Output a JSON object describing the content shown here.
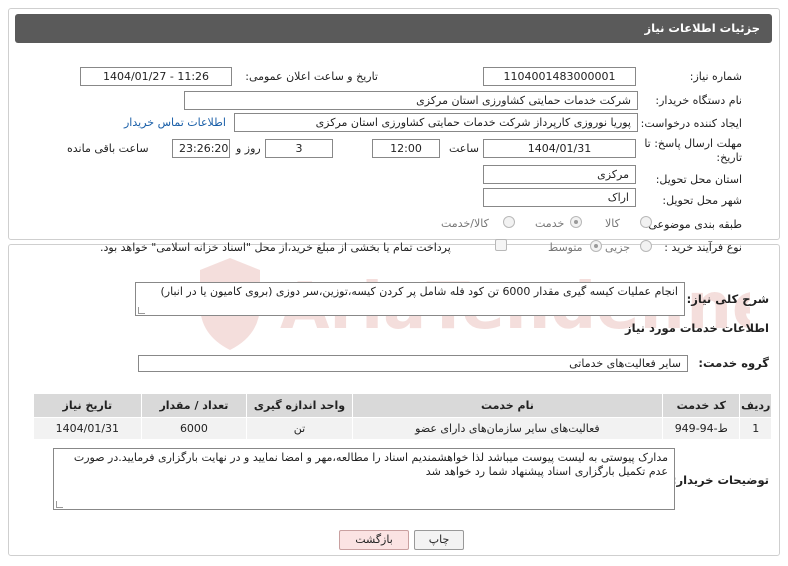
{
  "header": {
    "title": "جزئیات اطلاعات نیاز"
  },
  "fields": {
    "need_number": {
      "label": "شماره نیاز:",
      "value": "1104001483000001"
    },
    "announce_datetime": {
      "label": "تاریخ و ساعت اعلان عمومی:",
      "value": "1404/01/27 - 11:26"
    },
    "buyer_org": {
      "label": "نام دستگاه خریدار:",
      "value": "شرکت خدمات حمایتی کشاورزی استان مرکزی"
    },
    "requester": {
      "label": "ایجاد کننده درخواست:",
      "value": "پوریا نوروزی کارپرداز شرکت خدمات حمایتی کشاورزی استان مرکزی"
    },
    "buyer_contact_link": "اطلاعات تماس خریدار",
    "deadline": {
      "label_line1": "مهلت ارسال پاسخ: تا",
      "label_line2": "تاریخ:",
      "date": "1404/01/31",
      "time_label": "ساعت",
      "time": "12:00",
      "days": "3",
      "days_label": "روز و",
      "remaining": "23:26:20",
      "remaining_label": "ساعت باقی مانده"
    },
    "delivery_province": {
      "label": "استان محل تحویل:",
      "value": "مرکزی"
    },
    "delivery_city": {
      "label": "شهر محل تحویل:",
      "value": "اراک"
    },
    "category": {
      "label": "طبقه بندی موضوعی:",
      "options": [
        "کالا",
        "خدمت",
        "کالا/خدمت"
      ],
      "selected": "خدمت"
    },
    "purchase_type": {
      "label": "نوع فرآیند خرید :",
      "options": [
        "جزیی",
        "متوسط"
      ],
      "selected": "متوسط",
      "note": "پرداخت تمام یا بخشی از مبلغ خرید،از محل \"اسناد خزانه اسلامی\" خواهد بود."
    }
  },
  "summary": {
    "label": "شرح کلی نیاز:",
    "value": "انجام عملیات کیسه گیری مقدار 6000 تن کود فله شامل پر کردن کیسه،توزین،سر دوزی (بروی کامیون یا در انبار)"
  },
  "services": {
    "section_title": "اطلاعات خدمات مورد نیاز",
    "group_label": "گروه خدمت:",
    "group_value": "سایر فعالیت‌های خدماتی",
    "columns": [
      "ردیف",
      "کد خدمت",
      "نام خدمت",
      "واحد اندازه گیری",
      "تعداد / مقدار",
      "تاریخ نیاز"
    ],
    "rows": [
      {
        "row": "1",
        "code": "ط-94-949",
        "name": "فعالیت‌های سایر سازمان‌های دارای عضو",
        "unit": "تن",
        "qty": "6000",
        "date": "1404/01/31"
      }
    ]
  },
  "buyer_notes": {
    "label": "توضیحات خریدار:",
    "value": "مدارک پیوستی به لیست پیوست میباشد لذا خواهشمندیم اسناد را مطالعه،مهر و امضا نمایید و در نهایت بارگزاری فرمایید.در صورت عدم تکمیل بارگزاری اسناد پیشنهاد شما رد خواهد شد"
  },
  "buttons": {
    "print": "چاپ",
    "back": "بازگشت"
  },
  "watermark": {
    "text": "AriaTender.neT"
  },
  "colors": {
    "header_bg": "#5a5a5a",
    "link": "#1a5fa8",
    "back_button": "#fbe3e3"
  }
}
